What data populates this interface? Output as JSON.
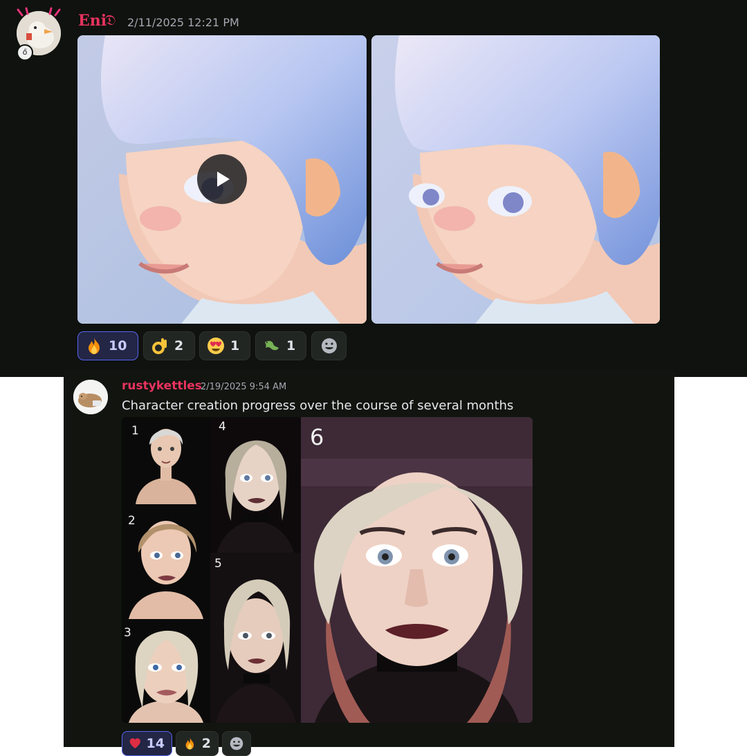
{
  "message1": {
    "username": "Eni",
    "username_suffix": "𝔇",
    "timestamp": "2/11/2025 12:21 PM",
    "username_color": "#e8335f",
    "reactions": [
      {
        "emoji": "fire",
        "count": "10",
        "active": true
      },
      {
        "emoji": "ok-hand",
        "count": "2",
        "active": false
      },
      {
        "emoji": "heart-eyes",
        "count": "1",
        "active": false
      },
      {
        "emoji": "lizard",
        "count": "1",
        "active": false
      }
    ]
  },
  "message2": {
    "username": "rustykettles",
    "timestamp": "2/19/2025 9:54 AM",
    "text": "Character creation progress over the course of several months",
    "username_color": "#e8335f",
    "grid_labels": [
      "1",
      "2",
      "3",
      "4",
      "5",
      "6"
    ],
    "reactions": [
      {
        "emoji": "heart",
        "count": "14",
        "active": true
      },
      {
        "emoji": "fire",
        "count": "2",
        "active": false
      }
    ]
  },
  "colors": {
    "accent": "#5865f2",
    "background": "#0f120e"
  }
}
